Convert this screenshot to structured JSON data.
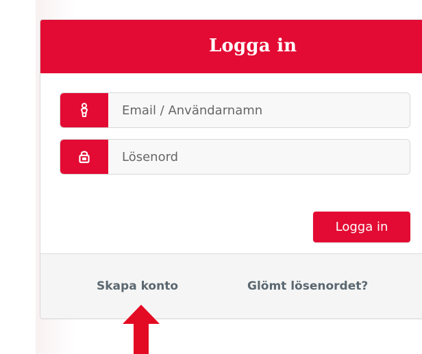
{
  "login": {
    "title": "Logga in",
    "email_placeholder": "Email / Användarnamn",
    "password_placeholder": "Lösenord",
    "submit_label": "Logga in",
    "create_account_label": "Skapa konto",
    "forgot_password_label": "Glömt lösenordet?"
  },
  "icons": {
    "user": "user-icon",
    "lock": "lock-icon",
    "annotation_arrow": "up-arrow-icon"
  },
  "colors": {
    "brand_red": "#e30b33",
    "footer_background": "#f5f5f5",
    "link_text": "#5a6770"
  }
}
